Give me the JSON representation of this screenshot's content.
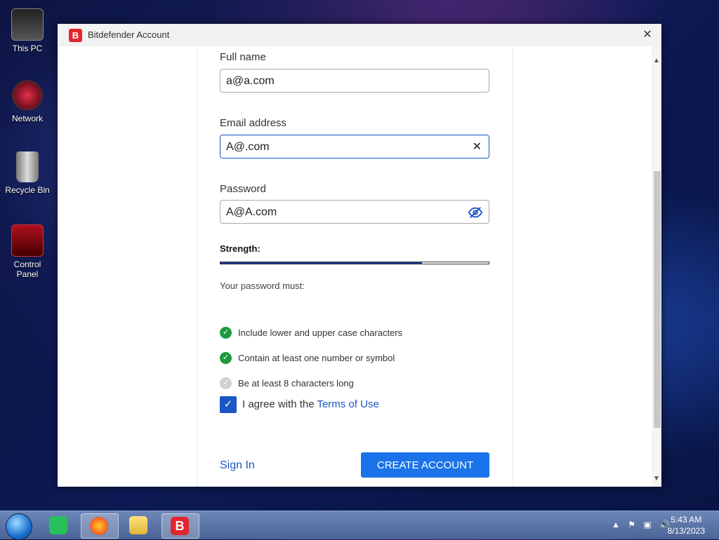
{
  "desktop": {
    "icons": [
      {
        "label": "This PC",
        "icon": "computer-icon"
      },
      {
        "label": "Network",
        "icon": "network-icon"
      },
      {
        "label": "Recycle Bin",
        "icon": "recycle-bin-icon"
      },
      {
        "label": "Control Panel",
        "icon": "control-panel-icon"
      }
    ]
  },
  "window": {
    "title": "Bitdefender Account",
    "logo_letter": "B",
    "close_glyph": "✕"
  },
  "form": {
    "full_name": {
      "label": "Full name",
      "value": "a@a.com"
    },
    "email": {
      "label": "Email address",
      "value": "A@.com",
      "clear_glyph": "✕"
    },
    "password": {
      "label": "Password",
      "value": "A@A.com",
      "toggle_icon": "eye-slash-icon"
    },
    "strength": {
      "label": "Strength:",
      "level_fraction": 0.75
    },
    "requirements_title": "Your password must:",
    "requirements": [
      {
        "text": "Include lower and upper case characters",
        "met": true
      },
      {
        "text": "Contain at least one number or symbol",
        "met": true
      },
      {
        "text": "Be at least 8 characters long",
        "met": false
      }
    ],
    "agree": {
      "prefix": "I agree with the",
      "link": "Terms of Use",
      "checked": true
    },
    "sign_in": "Sign In",
    "create_account": "CREATE ACCOUNT"
  },
  "taskbar": {
    "apps": [
      "greenshot",
      "firefox",
      "file-explorer",
      "bitdefender"
    ],
    "time": "5:43 AM",
    "date": "8/13/2023"
  },
  "colors": {
    "accent": "#1a73e8",
    "link": "#1a56c4",
    "success": "#1f9a3e",
    "brand": "#e3262e"
  }
}
